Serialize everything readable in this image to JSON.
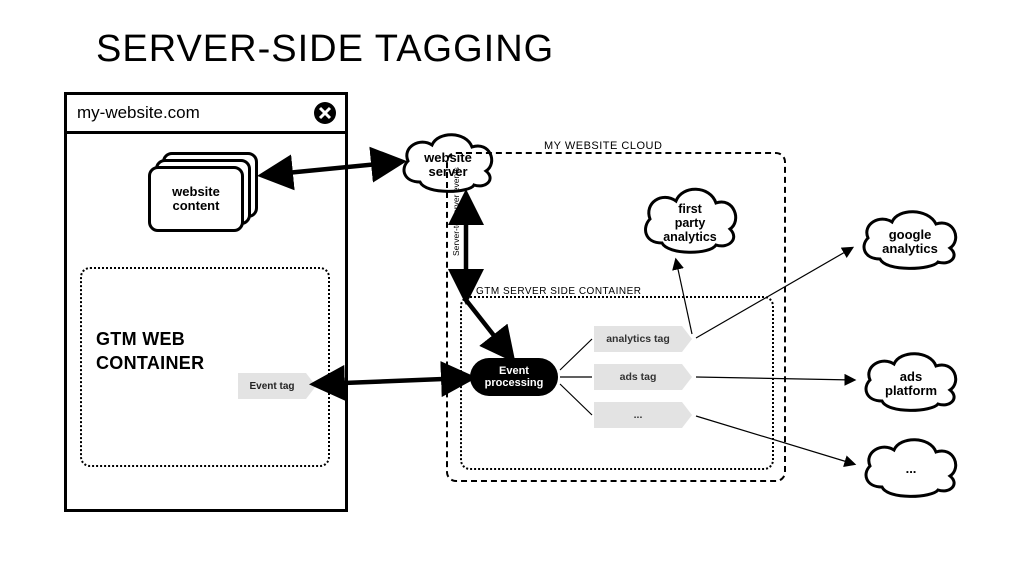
{
  "title": "SERVER-SIDE TAGGING",
  "browser": {
    "url": "my-website.com",
    "content_card": "website\ncontent",
    "gtm_web_label": "GTM WEB\nCONTAINER",
    "event_tag": "Event tag"
  },
  "website_server": "website\nserver",
  "my_website_cloud": "MY WEBSITE CLOUD",
  "gtm_server_label": "GTM SERVER SIDE CONTAINER",
  "event_processing": "Event\nprocessing",
  "server_to_server": "Server-to-server events",
  "tags": [
    "analytics tag",
    "ads tag",
    "..."
  ],
  "first_party_cloud": "first\nparty\nanalytics",
  "external_clouds": [
    "google\nanalytics",
    "ads\nplatform",
    "..."
  ]
}
